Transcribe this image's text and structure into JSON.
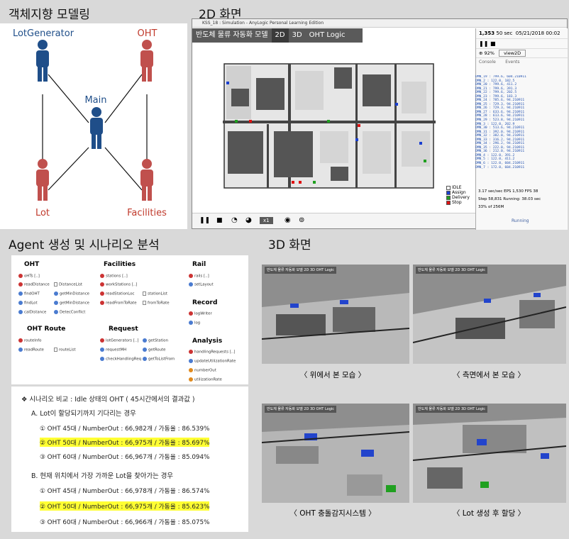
{
  "panel1": {
    "heading": "객체지향 모델링",
    "nodes": {
      "lot_generator": "LotGenerator",
      "oht": "OHT",
      "main": "Main",
      "lot": "Lot",
      "facilities": "Facilities"
    }
  },
  "panel2": {
    "heading": "2D 화면",
    "window_title": "KSS_18 : Simulation - AnyLogic Personal Learning Edition",
    "tabs": [
      "반도체 물류 자동화 모델",
      "2D",
      "3D",
      "OHT Logic"
    ],
    "legend": [
      {
        "label": "IDLE",
        "color": "#ffffff"
      },
      {
        "label": "Assign",
        "color": "#1a3fd0"
      },
      {
        "label": "Delivery",
        "color": "#1fa01f"
      },
      {
        "label": "Stop",
        "color": "#e01010"
      }
    ],
    "sidebar": {
      "time": "1,353",
      "time_unit": "50 sec",
      "date": "05/21/2018 00:02",
      "zoom": "92%",
      "view": "view2D",
      "console_tabs": [
        "Console",
        "Events"
      ],
      "log_lines": [
        "DMN_19 : 799.6, 604.210911",
        "DMN_2 : 122.0, 182.5",
        "DMN_20 : 799.6, 411.2",
        "DMN_21 : 799.6, 391.3",
        "DMN_22 : 799.6, 202.5",
        "DMN_23 : 799.6, 183.3",
        "DMN_24 : 785.6, 94.210911",
        "DMN_25 : 729.3, 94.210911",
        "DMN_26 : 729.3, 94.210911",
        "DMN_27 : 633.6, 94.210911",
        "DMN_28 : 613.6, 94.210911",
        "DMN_29 : 523.8, 94.210911",
        "DMN_3 : 122.0, 202.9",
        "DMN_30 : 513.6, 94.210911",
        "DMN_31 : 392.0, 94.210911",
        "DMN_32 : 382.0, 94.210911",
        "DMN_33 : 316.2, 94.210911",
        "DMN_34 : 296.2, 94.210911",
        "DMN_35 : 222.0, 94.210911",
        "DMN_36 : 212.0, 94.210911",
        "DMN_4 : 122.0, 391.2",
        "DMN_5 : 122.0, 411.2",
        "DMN_6 : 122.0, 604.210911",
        "DMN_7 : 172.0, 604.210911"
      ],
      "stats1": "3.17 sec/sec   EPS 1,530   FPS 38",
      "stats2": "Step 58,831   Running: 38.03 sec",
      "memory": "33% of 256M",
      "status": "Running"
    },
    "speed": "x1"
  },
  "panel3": {
    "heading": "Agent 생성 및 시나리오 분석",
    "sections": {
      "oht": {
        "title": "OHT",
        "items": [
          "oHTs [..]",
          "readDistance",
          "DistanceList",
          "findOHT",
          "getMinDistance",
          "findLot",
          "getMinDistance",
          "calDistance",
          "DetecConflict"
        ]
      },
      "facilities": {
        "title": "Facilities",
        "items": [
          "stations [..]",
          "workStations [..]",
          "readStationLoc",
          "stationList",
          "readFromToRate",
          "fromToRate"
        ]
      },
      "rail": {
        "title": "Rail",
        "items": [
          "rails [..]",
          "setLayout"
        ]
      },
      "record": {
        "title": "Record",
        "items": [
          "logWriter",
          "log"
        ]
      },
      "oht_route": {
        "title": "OHT Route",
        "items": [
          "routeInfo",
          "readRoute",
          "routeList"
        ]
      },
      "request": {
        "title": "Request",
        "items": [
          "lotGenerators [..]",
          "getStation",
          "requestMH",
          "getRoute",
          "checkHandlingReq",
          "getToListFrom"
        ]
      },
      "analysis": {
        "title": "Analysis",
        "items": [
          "handlingRequests [..]",
          "updateUtilizationRate",
          "numberOut",
          "utilizationRate"
        ]
      }
    },
    "scenario_title": "❖  시나리오 비교 : Idle 상태의 OHT       ( 45시간에서의 결과값 )",
    "case_a": "A. Lot이 할당되기까지 기다리는 경우",
    "case_a_rows": [
      "①  OHT 45대   /   NumberOut : 66,982개   /    가동율 : 86.539%",
      "②  OHT 50대   /   NumberOut : 66,975개   /    가동율 : 85.697%",
      "③  OHT 60대   /   NumberOut : 66,967개   /    가동율 : 85.094%"
    ],
    "case_b": "B. 현재 위치에서 가장 가까운 Lot을 찾아가는 경우",
    "case_b_rows": [
      "①  OHT 45대   /   NumberOut : 66,978개   /    가동율 : 86.574%",
      "②  OHT 50대   /   NumberOut : 66,975개   /    가동율 : 85.623%",
      "③  OHT 60대   /   NumberOut : 66,966개   /    가동율 : 85.075%"
    ]
  },
  "panel4": {
    "heading": "3D 화면",
    "mini_tab": "반도체 물류 자동화 모델  2D  3D  OHT Logic",
    "captions": [
      "〈 위에서 본 모습 〉",
      "〈 측면에서 본 모습 〉",
      "〈 OHT 충돌감지시스템 〉",
      "〈 Lot 생성 후 할당 〉"
    ]
  }
}
